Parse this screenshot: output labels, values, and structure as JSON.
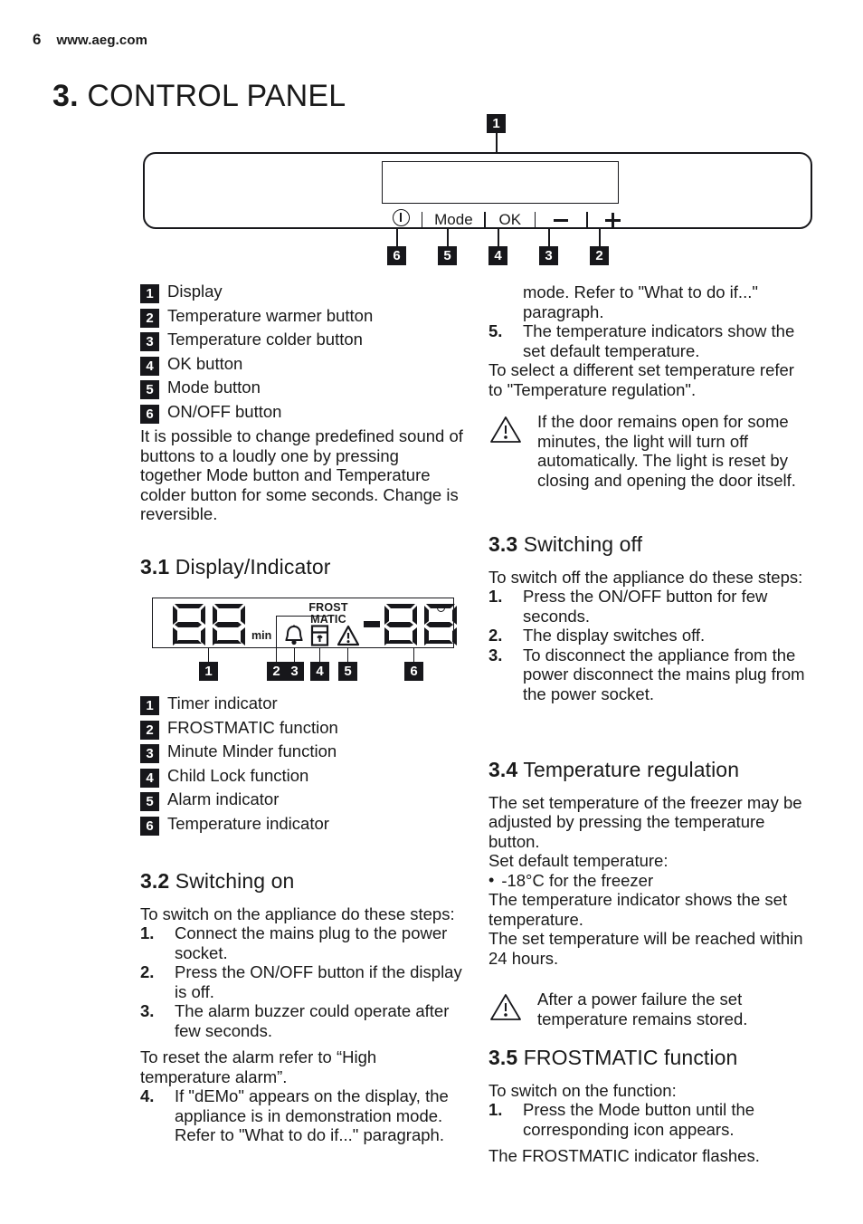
{
  "header": {
    "page_number": "6",
    "site": "www.aeg.com"
  },
  "chapter": {
    "number": "3.",
    "title": "CONTROL PANEL"
  },
  "panel_figure": {
    "top_callout": "1",
    "controls": [
      {
        "callout": "6",
        "label": "",
        "icon": "power-icon"
      },
      {
        "callout": "5",
        "label": "Mode",
        "icon": ""
      },
      {
        "callout": "4",
        "label": "OK",
        "icon": ""
      },
      {
        "callout": "3",
        "label": "",
        "icon": "minus-icon"
      },
      {
        "callout": "2",
        "label": "",
        "icon": "plus-icon"
      }
    ]
  },
  "panel_legend": [
    {
      "num": "1",
      "label": "Display"
    },
    {
      "num": "2",
      "label": "Temperature warmer button"
    },
    {
      "num": "3",
      "label": "Temperature colder button"
    },
    {
      "num": "4",
      "label": "OK button"
    },
    {
      "num": "5",
      "label": "Mode button"
    },
    {
      "num": "6",
      "label": "ON/OFF button"
    }
  ],
  "panel_note": "It is possible to change predefined sound of buttons to a loudly one by pressing together Mode button and Temperature colder button for some seconds. Change is reversible.",
  "section_31": {
    "number": "3.1",
    "title": "Display/Indicator",
    "lcd": {
      "timer_digits": "88",
      "timer_unit": "min",
      "frostmatic_line1": "FROST",
      "frostmatic_line2": "MATIC",
      "temp_digits": "-88",
      "degree": "°",
      "icons": [
        "bell-icon",
        "child-lock-icon",
        "warning-triangle-icon"
      ]
    },
    "callouts": [
      "1",
      "2",
      "3",
      "4",
      "5",
      "6"
    ],
    "legend": [
      {
        "num": "1",
        "label": "Timer indicator"
      },
      {
        "num": "2",
        "label": "FROSTMATIC function"
      },
      {
        "num": "3",
        "label": "Minute Minder function"
      },
      {
        "num": "4",
        "label": "Child Lock function"
      },
      {
        "num": "5",
        "label": "Alarm indicator"
      },
      {
        "num": "6",
        "label": "Temperature indicator"
      }
    ]
  },
  "section_32": {
    "number": "3.2",
    "title": "Switching on",
    "intro": "To switch on the appliance do these steps:",
    "steps": [
      {
        "marker": "1.",
        "text": "Connect the mains plug to the power socket."
      },
      {
        "marker": "2.",
        "text": "Press the ON/OFF button if the display is off."
      },
      {
        "marker": "3.",
        "text": "The alarm buzzer could operate after few seconds."
      },
      {
        "marker": "4.",
        "text": "If \"dEMo\" appears on the display, the appliance is in demonstration mode. Refer to \"What to do if...\" paragraph."
      },
      {
        "marker": "5.",
        "text": "The temperature indicators show the set default temperature."
      }
    ],
    "step3_sub": "To reset the alarm refer to “High temperature alarm”.",
    "closing": "To select a different set temperature refer to \"Temperature regulation\"."
  },
  "note_door": {
    "icon": "warning-triangle-icon",
    "text": "If the door remains open for some minutes, the light will turn off automatically. The light is reset by closing and opening the door itself."
  },
  "section_33": {
    "number": "3.3",
    "title": "Switching off",
    "intro": "To switch off the appliance do these steps:",
    "steps": [
      {
        "marker": "1.",
        "text": "Press the ON/OFF button for few seconds."
      },
      {
        "marker": "2.",
        "text": "The display switches off."
      },
      {
        "marker": "3.",
        "text": "To disconnect the appliance from the power disconnect the mains plug from the power socket."
      }
    ]
  },
  "section_34": {
    "number": "3.4",
    "title": "Temperature regulation",
    "para1": "The set temperature of the freezer may be adjusted by pressing the temperature button.",
    "para2": "Set default temperature:",
    "bullet": "-18°C for the freezer",
    "para3": "The temperature indicator shows the set temperature.",
    "para4": "The set temperature will be reached within 24 hours."
  },
  "note_power": {
    "icon": "warning-triangle-icon",
    "text": "After a power failure the set temperature remains stored."
  },
  "section_35": {
    "number": "3.5",
    "title": "FROSTMATIC function",
    "intro": "To switch on the function:",
    "steps": [
      {
        "marker": "1.",
        "text": "Press the Mode button until the corresponding icon appears."
      }
    ],
    "step1_sub": "The FROSTMATIC indicator flashes."
  },
  "colors": {
    "ink": "#17171b",
    "paper": "#ffffff"
  }
}
